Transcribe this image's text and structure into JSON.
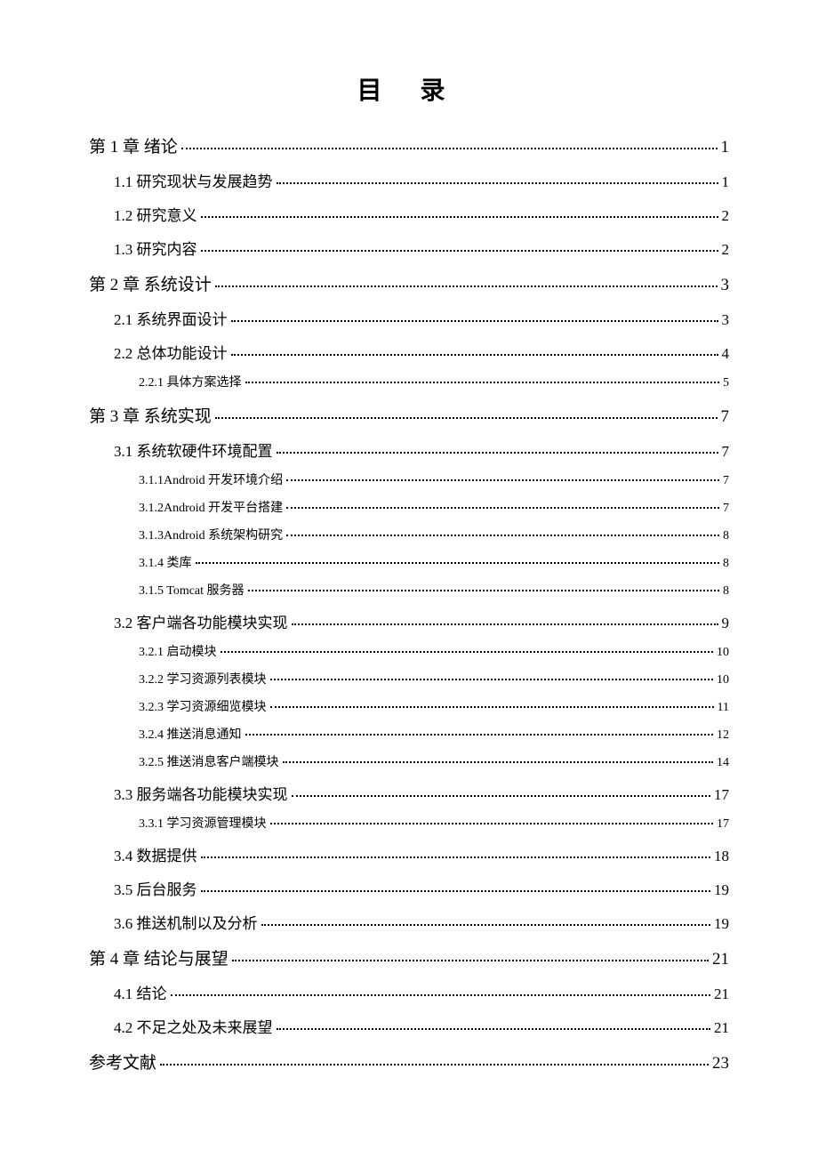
{
  "title": "目 录",
  "entries": [
    {
      "level": 0,
      "label": "第 1 章  绪论",
      "page": "1"
    },
    {
      "level": 1,
      "label": "1.1  研究现状与发展趋势",
      "page": "1"
    },
    {
      "level": 1,
      "label": "1.2  研究意义",
      "page": "2"
    },
    {
      "level": 1,
      "label": "1.3  研究内容",
      "page": "2"
    },
    {
      "level": 0,
      "label": "第 2 章  系统设计",
      "page": "3"
    },
    {
      "level": 1,
      "label": "2.1 系统界面设计",
      "page": "3"
    },
    {
      "level": 1,
      "label": "2.2  总体功能设计",
      "page": "4"
    },
    {
      "level": 2,
      "label": "2.2.1 具体方案选择",
      "page": "5"
    },
    {
      "level": 0,
      "label": "第 3 章  系统实现",
      "page": "7"
    },
    {
      "level": 1,
      "label": "3.1  系统软硬件环境配置",
      "page": "7"
    },
    {
      "level": 2,
      "label": "3.1.1Android 开发环境介绍",
      "page": "7"
    },
    {
      "level": 2,
      "label": "3.1.2Android 开发平台搭建",
      "page": "7"
    },
    {
      "level": 2,
      "label": "3.1.3Android 系统架构研究",
      "page": "8"
    },
    {
      "level": 2,
      "label": "3.1.4 类库",
      "page": "8"
    },
    {
      "level": 2,
      "label": "3.1.5 Tomcat 服务器",
      "page": "8"
    },
    {
      "level": 1,
      "label": "3.2  客户端各功能模块实现",
      "page": "9"
    },
    {
      "level": 2,
      "label": "3.2.1 启动模块",
      "page": "10"
    },
    {
      "level": 2,
      "label": "3.2.2  学习资源列表模块",
      "page": "10"
    },
    {
      "level": 2,
      "label": "3.2.3  学习资源细览模块",
      "page": "11"
    },
    {
      "level": 2,
      "label": "3.2.4  推送消息通知",
      "page": "12"
    },
    {
      "level": 2,
      "label": "3.2.5  推送消息客户端模块",
      "page": "14"
    },
    {
      "level": 1,
      "label": "3.3  服务端各功能模块实现",
      "page": "17"
    },
    {
      "level": 2,
      "label": "3.3.1 学习资源管理模块",
      "page": "17"
    },
    {
      "level": 1,
      "label": "3.4  数据提供",
      "page": "18"
    },
    {
      "level": 1,
      "label": "3.5  后台服务",
      "page": "19"
    },
    {
      "level": 1,
      "label": "3.6  推送机制以及分析",
      "page": "19"
    },
    {
      "level": 0,
      "label": "第 4 章  结论与展望",
      "page": "21"
    },
    {
      "level": 1,
      "label": "4.1  结论",
      "page": "21"
    },
    {
      "level": 1,
      "label": "4.2  不足之处及未来展望",
      "page": "21"
    },
    {
      "level": 0,
      "label": "参考文献",
      "page": "23"
    }
  ]
}
